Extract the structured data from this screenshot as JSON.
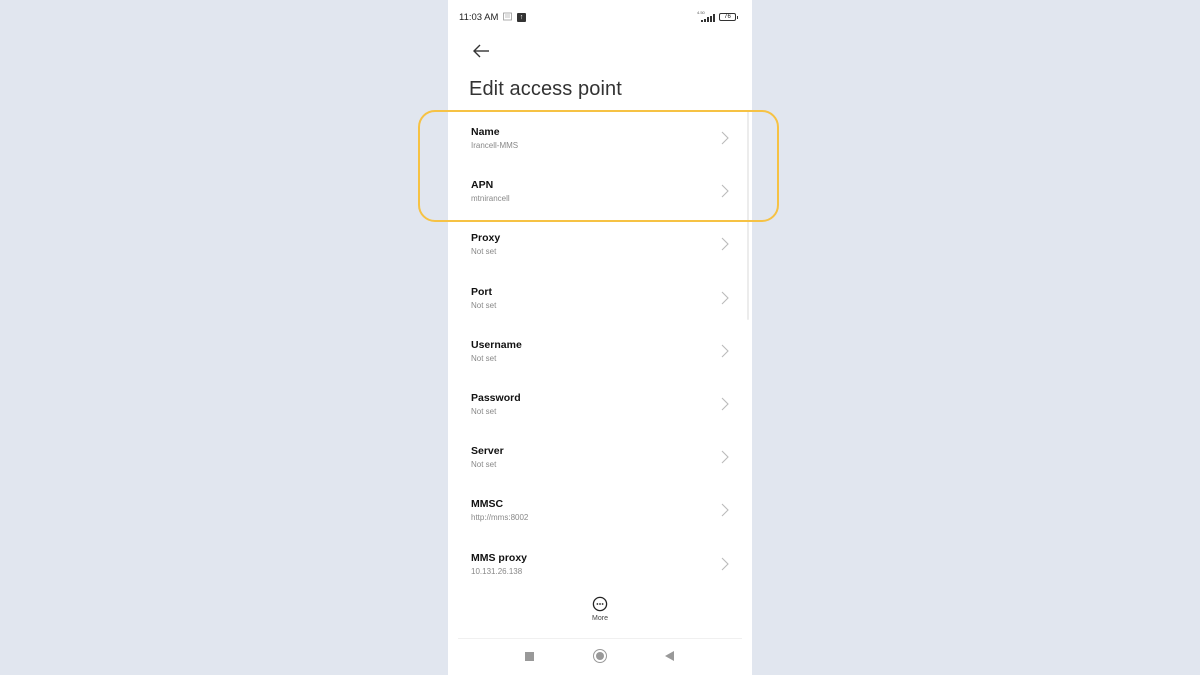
{
  "status_bar": {
    "time": "11:03 AM",
    "notification_icon": "notification-icon",
    "upload_icon": "upload-icon",
    "network_speed": "4.50",
    "signal_icon": "signal-bars-icon",
    "battery": "76"
  },
  "header": {
    "back_icon": "arrow-left-icon",
    "title": "Edit access point"
  },
  "settings": [
    {
      "label": "Name",
      "value": "Irancell-MMS"
    },
    {
      "label": "APN",
      "value": "mtnirancell"
    },
    {
      "label": "Proxy",
      "value": "Not set"
    },
    {
      "label": "Port",
      "value": "Not set"
    },
    {
      "label": "Username",
      "value": "Not set"
    },
    {
      "label": "Password",
      "value": "Not set"
    },
    {
      "label": "Server",
      "value": "Not set"
    },
    {
      "label": "MMSC",
      "value": "http://mms:8002"
    },
    {
      "label": "MMS proxy",
      "value": "10.131.26.138"
    }
  ],
  "bottom_action": {
    "more_label": "More",
    "more_icon": "more-horizontal-circle-icon"
  },
  "nav_bar": {
    "recents_icon": "square-icon",
    "home_icon": "circle-icon",
    "back_icon": "triangle-back-icon"
  },
  "annotation": {
    "highlight_color": "#f6c244"
  }
}
